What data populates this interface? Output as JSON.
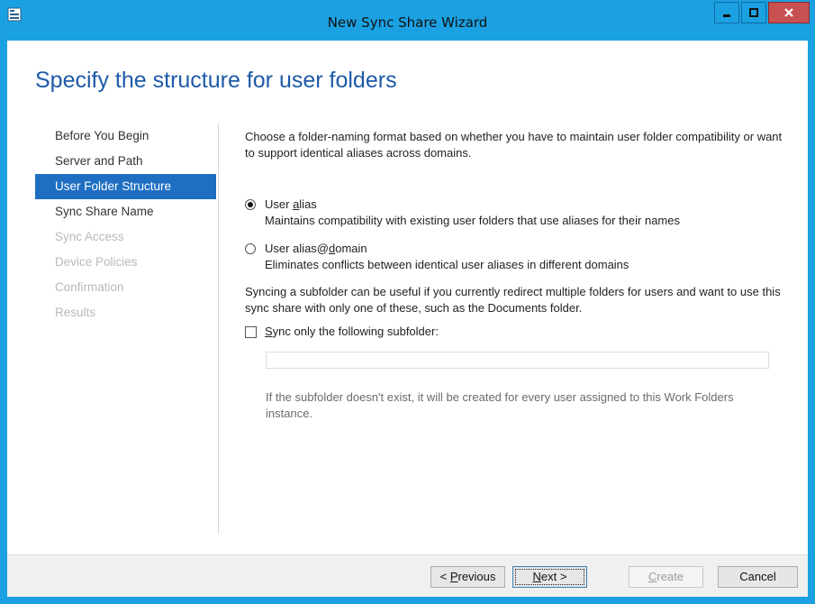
{
  "window": {
    "title": "New Sync Share Wizard",
    "accent": "#1ba1e2",
    "close_color": "#c75050"
  },
  "page": {
    "heading": "Specify the structure for user folders"
  },
  "nav": {
    "items": [
      {
        "label": "Before You Begin",
        "state": "normal"
      },
      {
        "label": "Server and Path",
        "state": "normal"
      },
      {
        "label": "User Folder Structure",
        "state": "active"
      },
      {
        "label": "Sync Share Name",
        "state": "normal"
      },
      {
        "label": "Sync Access",
        "state": "disabled"
      },
      {
        "label": "Device Policies",
        "state": "disabled"
      },
      {
        "label": "Confirmation",
        "state": "disabled"
      },
      {
        "label": "Results",
        "state": "disabled"
      }
    ]
  },
  "content": {
    "intro": "Choose a folder-naming format based on whether you have to maintain user folder compatibility or want to support identical aliases across domains.",
    "option_alias": {
      "label_pre": "User ",
      "label_mnemonic": "a",
      "label_post": "lias",
      "description": "Maintains compatibility with existing user folders that use aliases for their names",
      "selected": true
    },
    "option_alias_domain": {
      "label_pre": "User alias@",
      "label_mnemonic": "d",
      "label_post": "omain",
      "description": "Eliminates conflicts between identical user aliases in different domains",
      "selected": false
    },
    "subfolder_intro": "Syncing a subfolder can be useful if you currently redirect multiple folders for users and want to use this sync share with only one of these, such as the Documents folder.",
    "subfolder_checkbox": {
      "label_mnemonic": "S",
      "label_post": "ync only the following subfolder:",
      "checked": false
    },
    "subfolder_value": "",
    "subfolder_note": "If the subfolder doesn't exist, it will be created for every user assigned to this Work Folders instance."
  },
  "buttons": {
    "previous": {
      "pre": "< ",
      "mnemonic": "P",
      "post": "revious"
    },
    "next": {
      "pre": "",
      "mnemonic": "N",
      "post": "ext >"
    },
    "create": {
      "pre": "",
      "mnemonic": "C",
      "post": "reate"
    },
    "cancel": "Cancel"
  }
}
